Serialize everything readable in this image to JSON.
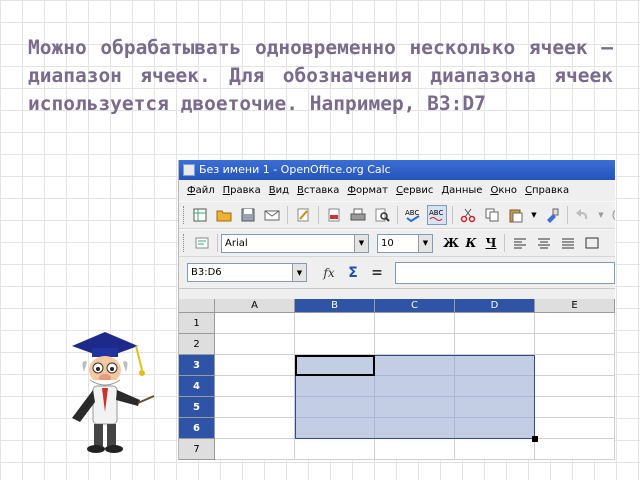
{
  "slide": {
    "text": "Можно обрабатывать одновременно несколько ячеек — диапазон ячеек. Для обозначения диапазона ячеек используется двоеточие. Например, B3:D7"
  },
  "window": {
    "title": "Без имени 1 - OpenOffice.org Calc"
  },
  "menu": [
    {
      "underline": "Ф",
      "rest": "айл"
    },
    {
      "underline": "П",
      "rest": "равка"
    },
    {
      "underline": "В",
      "rest": "ид"
    },
    {
      "underline": "В",
      "rest": "ставка"
    },
    {
      "underline": "Ф",
      "rest": "ормат"
    },
    {
      "underline": "С",
      "rest": "ервис"
    },
    {
      "underline": "Д",
      "rest": "анные"
    },
    {
      "underline": "О",
      "rest": "кно"
    },
    {
      "underline": "С",
      "rest": "правка"
    }
  ],
  "format_toolbar": {
    "font_name": "Arial",
    "font_size": "10",
    "bold": "Ж",
    "italic": "К",
    "underline": "Ч"
  },
  "formula_bar": {
    "name_box": "B3:D6",
    "function_symbol": "fx",
    "sum_symbol": "Σ",
    "equals_symbol": "="
  },
  "sheet": {
    "columns": [
      "A",
      "B",
      "C",
      "D",
      "E"
    ],
    "rows": [
      "1",
      "2",
      "3",
      "4",
      "5",
      "6",
      "7"
    ],
    "selected_columns": [
      "B",
      "C",
      "D"
    ],
    "selected_rows": [
      "3",
      "4",
      "5",
      "6"
    ],
    "active_cell": "B3"
  },
  "colors": {
    "slide_text": "#7a6a8c",
    "title_bar": "#2553b9",
    "selected_header": "#2f53a6",
    "selection_fill": "#c3cde3"
  }
}
